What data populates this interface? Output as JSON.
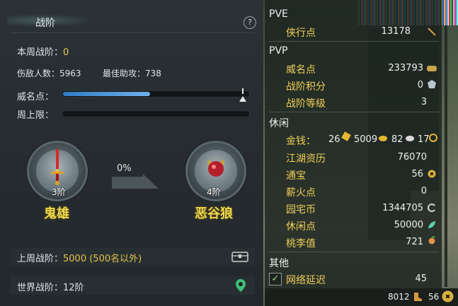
{
  "left_panel": {
    "title": "战阶",
    "help_label": "?",
    "weekly_rank_label": "本周战阶：",
    "weekly_rank_value": "0",
    "kills_label": "伤敌人数：",
    "kills_value": "5963",
    "best_assist_label": "最佳助攻：",
    "best_assist_value": "738",
    "prestige_label": "威名点：",
    "prestige_progress": 0.47,
    "weekly_cap_label": "周上限：",
    "current_rank_level": "3阶",
    "current_rank_name": "鬼雄",
    "progress_percent": "0%",
    "next_rank_level": "4阶",
    "next_rank_name": "恶谷狼",
    "last_week_label": "上周战阶：",
    "last_week_value": "5000 (500名以外)",
    "world_rank_label": "世界战阶：",
    "world_rank_value": "12阶"
  },
  "right_panel": {
    "pve_header": "PVE",
    "pve_items": [
      {
        "label": "侠行点",
        "value": "13178"
      }
    ],
    "pvp_header": "PVP",
    "pvp_items": [
      {
        "label": "威名点",
        "value": "233793"
      },
      {
        "label": "战阶积分",
        "value": "0"
      },
      {
        "label": "战阶等级",
        "value": "3"
      }
    ],
    "leisure_header": "休闲",
    "money_label": "金钱：",
    "money_gold": "26",
    "money_silver": "5009",
    "money_copper_a": "82",
    "money_copper_b": "17",
    "leisure_items": [
      {
        "label": "江湖资历",
        "value": "76070"
      },
      {
        "label": "通宝",
        "value": "56"
      },
      {
        "label": "薪火点",
        "value": "0"
      },
      {
        "label": "园宅币",
        "value": "1344705"
      },
      {
        "label": "休闲点",
        "value": "50000"
      },
      {
        "label": "桃李值",
        "value": "721"
      }
    ],
    "other_header": "其他",
    "latency_label": "网络延迟",
    "latency_value": "45",
    "checkbox_checked": true
  },
  "bottom_bar": {
    "value_a": "8012",
    "value_b": "56"
  },
  "colors": {
    "gold_text": "#f0d056",
    "rank_name": "#f1d84c",
    "progress_blue": "#2f7cc5"
  }
}
